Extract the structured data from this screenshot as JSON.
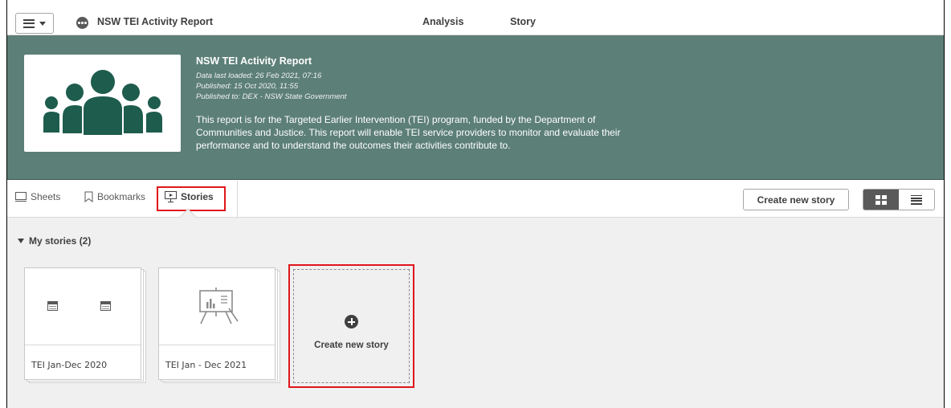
{
  "toolbar": {
    "app_title": "NSW TEI Activity Report",
    "nav": [
      "Analysis",
      "Story"
    ]
  },
  "banner": {
    "title": "NSW TEI Activity Report",
    "data_loaded": "Data last loaded: 26 Feb 2021, 07:16",
    "published": "Published: 15 Oct 2020, 11:55",
    "published_to": "Published to: DEX - NSW State Government",
    "description": "This report is for the Targeted Earlier Intervention (TEI) program, funded by the Department of Communities and Justice. This report will enable TEI service providers to monitor and evaluate their performance and to understand the outcomes their activities contribute to.",
    "bg_color": "#5c7f77"
  },
  "tabs": [
    {
      "label": "Sheets",
      "icon": "sheet-icon",
      "active": false
    },
    {
      "label": "Bookmarks",
      "icon": "bookmark-icon",
      "active": false
    },
    {
      "label": "Stories",
      "icon": "story-icon",
      "active": true
    }
  ],
  "actions": {
    "create_new_story": "Create new story",
    "view_modes": [
      "grid-icon",
      "list-icon"
    ],
    "active_view": "grid"
  },
  "stories_section": {
    "heading": "My stories (2)",
    "cards": [
      {
        "label": "TEI Jan-Dec 2020",
        "thumb": "sheet-icons"
      },
      {
        "label": "TEI Jan - Dec 2021",
        "thumb": "presentation-icon"
      }
    ],
    "create_card_label": "Create new story"
  },
  "highlight_color": "#e0161b"
}
